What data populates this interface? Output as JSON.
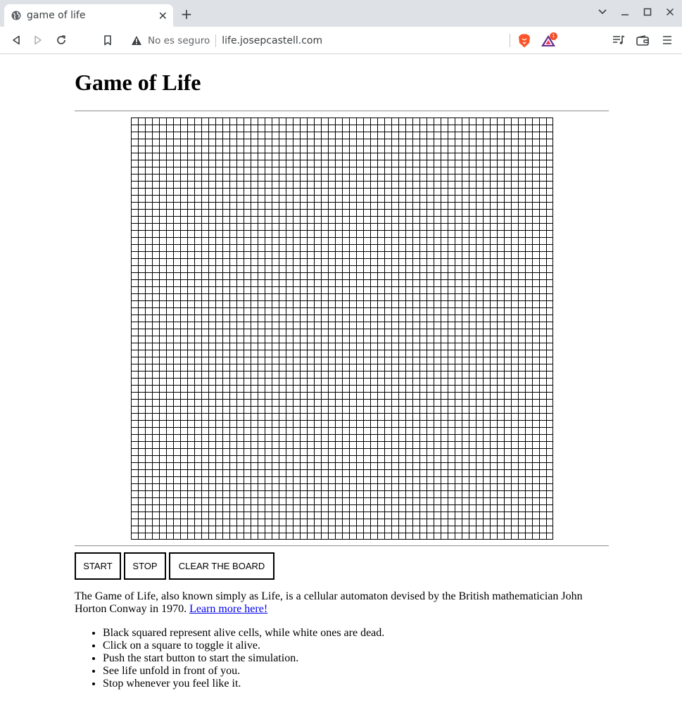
{
  "browser": {
    "tab_title": "game of life",
    "new_tab_glyph": "+",
    "close_glyph": "✕",
    "security_label": "No es seguro",
    "url": "life.josepcastell.com",
    "rewards_badge": "1",
    "icons": [
      "globe-icon",
      "back-icon",
      "forward-icon",
      "reload-icon",
      "bookmark-icon",
      "warning-icon",
      "brave-shields-icon",
      "brave-rewards-icon",
      "playlist-icon",
      "wallet-icon",
      "menu-icon",
      "chevron-down-icon",
      "minimize-icon",
      "maximize-icon",
      "close-window-icon"
    ]
  },
  "page": {
    "title": "Game of Life",
    "board": {
      "rows": 60,
      "cols": 60,
      "alive_cells": 0
    },
    "buttons": {
      "start": "START",
      "stop": "STOP",
      "clear": "CLEAR THE BOARD"
    },
    "description": "The Game of Life, also known simply as Life, is a cellular automaton devised by the British mathematician John Horton Conway in 1970.",
    "learn_more": "Learn more here!",
    "bullets": [
      "Black squared represent alive cells, while white ones are dead.",
      "Click on a square to toggle it alive.",
      "Push the start button to start the simulation.",
      "See life unfold in front of you.",
      "Stop whenever you feel like it."
    ]
  },
  "colors": {
    "link": "#0000ee",
    "tabstrip": "#dee1e6",
    "rewards_badge": "#f0532c",
    "brave_orange": "#fb542b"
  }
}
